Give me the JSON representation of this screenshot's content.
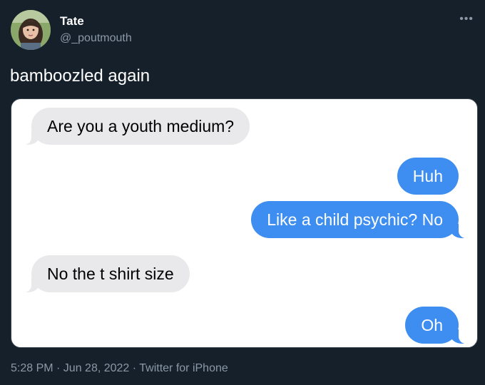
{
  "author": {
    "name": "Tate",
    "handle": "@_poutmouth"
  },
  "tweet": {
    "text": "bamboozled again",
    "more_icon": "more-horizontal-icon"
  },
  "conversation": [
    {
      "side": "incoming",
      "text": "Are you a youth medium?"
    },
    {
      "side": "outgoing",
      "text": "Huh"
    },
    {
      "side": "outgoing",
      "text": "Like a child psychic? No"
    },
    {
      "side": "incoming",
      "text": "No the t shirt size"
    },
    {
      "side": "outgoing",
      "text": "Oh"
    }
  ],
  "meta": {
    "posted": "5:28 PM · Jun 28, 2022 · Twitter for iPhone"
  },
  "colors": {
    "background": "#15202b",
    "incoming_bubble": "#e9e9eb",
    "outgoing_bubble": "#3d8ef0",
    "muted_text": "#8b98a5"
  }
}
